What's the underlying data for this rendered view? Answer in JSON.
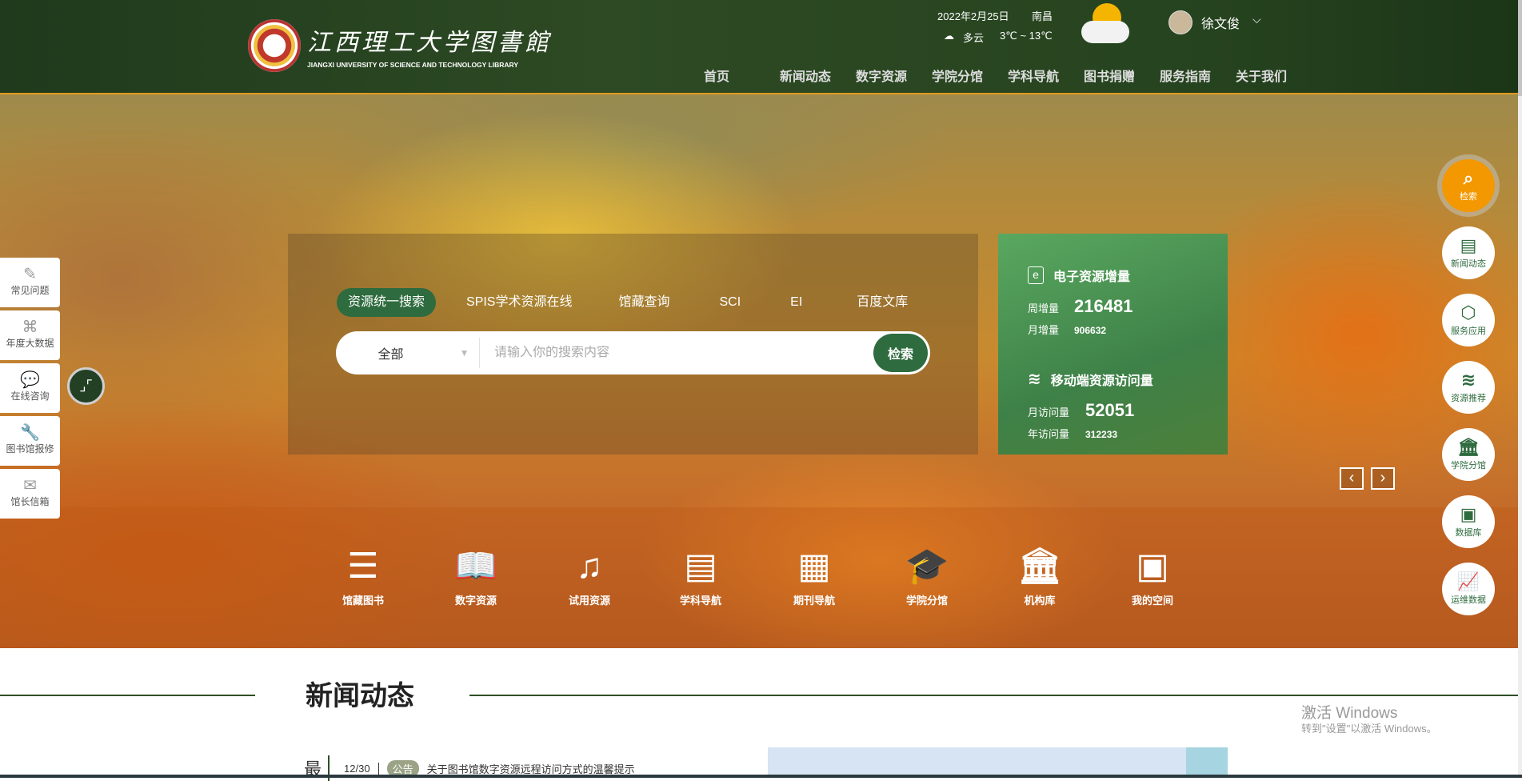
{
  "header": {
    "logo_cn": "江西理工大学图書館",
    "logo_en": "JIANGXI UNIVERSITY OF SCIENCE AND TECHNOLOGY LIBRARY",
    "date": "2022年2月25日",
    "city": "南昌",
    "weather": "多云",
    "temp": "3℃ ~ 13℃",
    "user": "徐文俊",
    "nav": [
      "首页",
      "新闻动态",
      "数字资源",
      "学院分馆",
      "学科导航",
      "图书捐赠",
      "服务指南",
      "关于我们"
    ]
  },
  "search": {
    "tabs": [
      "资源统一搜索",
      "SPIS学术资源在线",
      "馆藏查询",
      "SCI",
      "EI",
      "百度文库"
    ],
    "scope": "全部",
    "placeholder": "请输入你的搜索内容",
    "button": "检索"
  },
  "stats": {
    "e_title": "电子资源增量",
    "week_label": "周增量",
    "week": "216481",
    "month_label": "月增量",
    "month": "906632",
    "m_title": "移动端资源访问量",
    "mvisit_label": "月访问量",
    "mvisit": "52051",
    "yvisit_label": "年访问量",
    "yvisit": "312233"
  },
  "quick": [
    "馆藏图书",
    "数字资源",
    "试用资源",
    "学科导航",
    "期刊导航",
    "学院分馆",
    "机构库",
    "我的空间"
  ],
  "left": [
    "常见问题",
    "年度大数据",
    "在线咨询",
    "图书馆报修",
    "馆长信箱"
  ],
  "right": [
    "检索",
    "新闻动态",
    "服务应用",
    "资源推荐",
    "学院分馆",
    "数据库",
    "运维数据"
  ],
  "news": {
    "title": "新闻动态",
    "tab": "最",
    "date": "12/30",
    "badge": "公告",
    "item": "关于图书馆数字资源远程访问方式的温馨提示"
  },
  "watermark": {
    "l1": "激活 Windows",
    "l2": "转到\"设置\"以激活 Windows。"
  }
}
